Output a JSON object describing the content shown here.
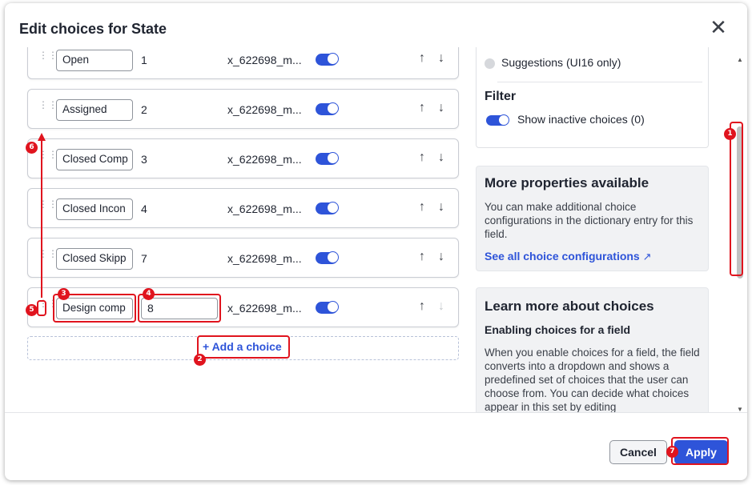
{
  "dialog": {
    "title": "Edit choices for State",
    "close_icon": "close-icon"
  },
  "choices": [
    {
      "label": "Open",
      "sequence": "1",
      "value": "x_622698_m...",
      "active": true
    },
    {
      "label": "Assigned",
      "sequence": "2",
      "value": "x_622698_m...",
      "active": true
    },
    {
      "label": "Closed Comp",
      "sequence": "3",
      "value": "x_622698_m...",
      "active": true
    },
    {
      "label": "Closed Incon",
      "sequence": "4",
      "value": "x_622698_m...",
      "active": true
    },
    {
      "label": "Closed Skipp",
      "sequence": "7",
      "value": "x_622698_m...",
      "active": true
    },
    {
      "label": "Design comp",
      "sequence": "8",
      "value": "x_622698_m...",
      "active": true
    }
  ],
  "row_controls": {
    "up": "↑",
    "down": "↓",
    "grip_icon": "drag-handle-icon"
  },
  "add_choice": {
    "plus": "+",
    "label": "Add a choice"
  },
  "right_panel": {
    "suggestions_label": "Suggestions (UI16 only)",
    "filter_heading": "Filter",
    "show_inactive_label": "Show inactive choices (0)",
    "more_props": {
      "heading": "More properties available",
      "body": "You can make additional choice configurations in the dictionary entry for this field.",
      "link": "See all choice configurations",
      "link_icon": "external-link-icon"
    },
    "learn_more": {
      "heading": "Learn more about choices",
      "subheading": "Enabling choices for a field",
      "body": "When you enable choices for a field, the field converts into a dropdown and shows a predefined set of choices that the user can choose from. You can decide what choices appear in this set by editing"
    }
  },
  "footer": {
    "cancel_label": "Cancel",
    "apply_label": "Apply"
  },
  "annotations": [
    "1",
    "2",
    "3",
    "4",
    "5",
    "6",
    "7"
  ],
  "colors": {
    "accent": "#2e54d9",
    "annotation": "#e0141e"
  }
}
